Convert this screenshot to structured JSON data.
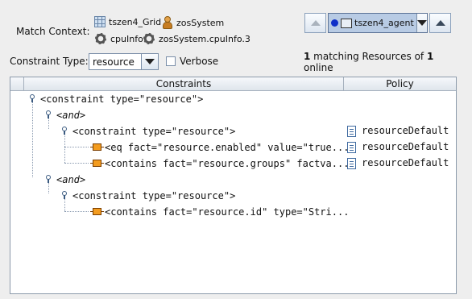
{
  "match_context": {
    "label": "Match Context:",
    "items": [
      {
        "name": "tszen4_Grid",
        "icon": "grid-icon"
      },
      {
        "name": "zosSystem",
        "icon": "agent-icon"
      },
      {
        "name": "cpuInfo",
        "icon": "gear-icon"
      },
      {
        "name": "zosSystem.cpuInfo.3",
        "icon": "gear-icon"
      }
    ]
  },
  "agent_selector": {
    "value": "tszen4_agent",
    "status_color": "#1030c8"
  },
  "constraint_type": {
    "label": "Constraint Type:",
    "value": "resource"
  },
  "verbose": {
    "label": "Verbose",
    "checked": false
  },
  "match_summary": {
    "count": "1",
    "text1": " matching Resources of ",
    "total": "1",
    "text2": "online"
  },
  "table": {
    "columns": [
      "Constraints",
      "Policy"
    ],
    "rows": [
      {
        "text": "<constraint type=\"resource\">",
        "policy": ""
      },
      {
        "text": "<and>",
        "policy": ""
      },
      {
        "text": "<constraint type=\"resource\">",
        "policy": "resourceDefault"
      },
      {
        "text": "<eq fact=\"resource.enabled\" value=\"true...",
        "policy": "resourceDefault"
      },
      {
        "text": "<contains fact=\"resource.groups\" factva...",
        "policy": "resourceDefault"
      },
      {
        "text": "<and>",
        "policy": ""
      },
      {
        "text": "<constraint type=\"resource\">",
        "policy": ""
      },
      {
        "text": "<contains fact=\"resource.id\" type=\"Stri...",
        "policy": ""
      }
    ]
  }
}
